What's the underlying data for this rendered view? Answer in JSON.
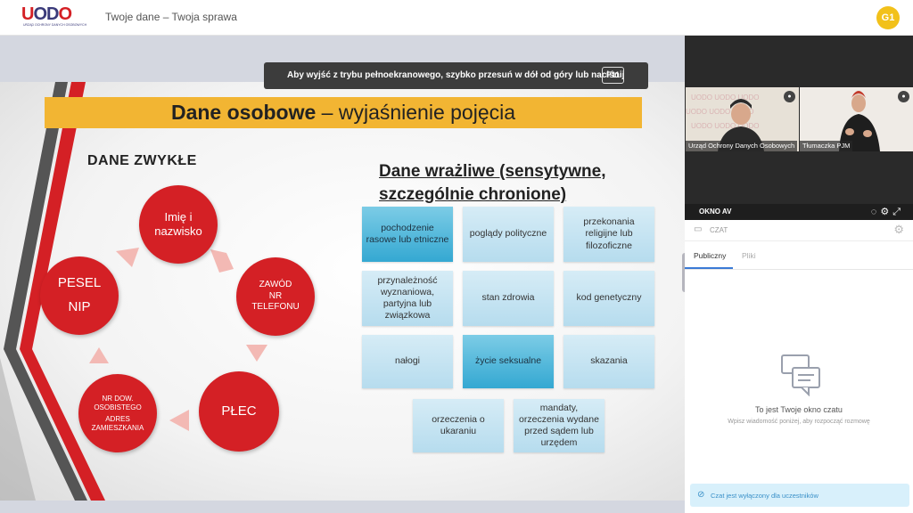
{
  "header": {
    "logo_text": "UODO",
    "logo_sub": "URZĄD OCHRONY DANYCH OSOBOWYCH",
    "page_title": "Twoje dane – Twoja sprawa",
    "avatar": "G1"
  },
  "fullscreen_banner": {
    "text": "Aby wyjść z trybu pełnoekranowego, szybko przesuń w dół od góry lub naciśnij",
    "key": "F11"
  },
  "slide": {
    "title_bold": "Dane osobowe",
    "title_rest": " – wyjaśnienie pojęcia",
    "heading_zwykle": "DANE ZWYKŁE",
    "heading_wrazliwe_1": "Dane wrażliwe (sensytywne,",
    "heading_wrazliwe_2": "szczególnie chronione)",
    "circles": {
      "imie": [
        "Imię i",
        "nazwisko"
      ],
      "zawod": [
        "ZAWÓD",
        "NR",
        "TELEFONU"
      ],
      "plec": [
        "PŁEC"
      ],
      "nrdow": [
        "NR DOW.",
        "OSOBISTEGO",
        "ADRES",
        "ZAMIESZKANIA"
      ],
      "pesel": [
        "PESEL",
        "NIP"
      ]
    },
    "boxes": [
      "pochodzenie rasowe lub etniczne",
      "poglądy polityczne",
      "przekonania religijne lub filozoficzne",
      "przynależność wyznaniowa, partyjna lub związkowa",
      "stan zdrowia",
      "kod genetyczny",
      "nałogi",
      "życie seksualne",
      "skazania",
      "orzeczenia o ukaraniu",
      "mandaty, orzeczenia wydane przed sądem lub urzędem"
    ]
  },
  "video": {
    "tile1_label": "Urząd Ochrony Danych Osobowych",
    "tile2_label": "Tłumaczka PJM",
    "av_label": "OKNO AV"
  },
  "chat": {
    "header_label": "CZAT",
    "tab_public": "Publiczny",
    "tab_files": "Pliki",
    "empty_title": "To jest Twoje okno czatu",
    "empty_sub": "Wpisz wiadomość poniżej, aby rozpocząć rozmowę",
    "disabled_notice": "Czat jest wyłączony dla uczestników"
  },
  "colors": {
    "accent_red": "#d42025",
    "title_bar": "#f2b533",
    "avatar": "#f2c11a",
    "box_light": "#c6e4f2",
    "box_dark": "#34a8d2"
  }
}
